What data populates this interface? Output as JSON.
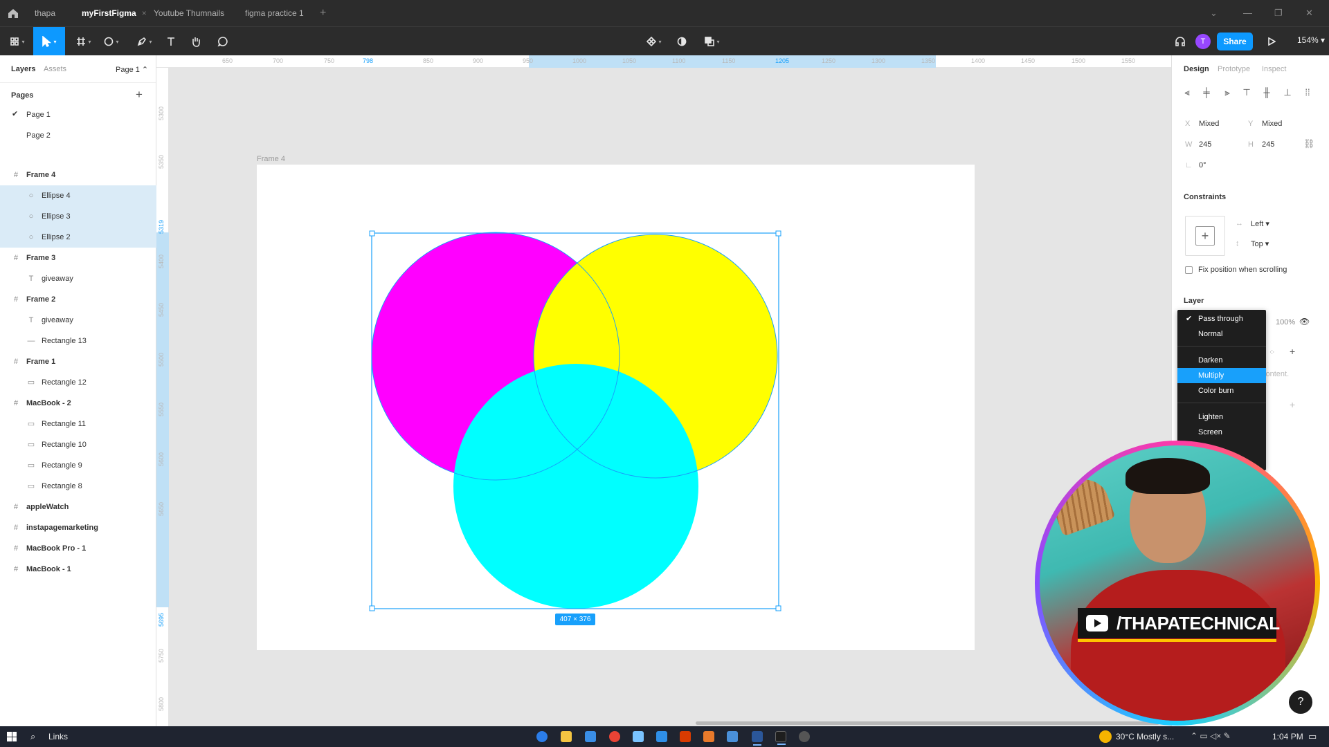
{
  "tabs": [
    {
      "label": "thapa",
      "active": false
    },
    {
      "label": "myFirstFigma",
      "active": true
    },
    {
      "label": "Youtube Thumnails",
      "active": false
    },
    {
      "label": "figma practice 1",
      "active": false
    }
  ],
  "toolbar": {
    "share_label": "Share",
    "zoom": "154%",
    "avatar_letter": "T"
  },
  "left_panel": {
    "tab_layers": "Layers",
    "tab_assets": "Assets",
    "page_selector": "Page 1",
    "pages_header": "Pages",
    "pages": [
      "Page 1",
      "Page 2"
    ],
    "layers": [
      {
        "label": "Frame 4",
        "type": "frame"
      },
      {
        "label": "Ellipse 4",
        "type": "ellipse"
      },
      {
        "label": "Ellipse 3",
        "type": "ellipse"
      },
      {
        "label": "Ellipse 2",
        "type": "ellipse"
      },
      {
        "label": "Frame 3",
        "type": "frame"
      },
      {
        "label": "giveaway",
        "type": "text"
      },
      {
        "label": "Frame 2",
        "type": "frame"
      },
      {
        "label": "giveaway",
        "type": "text"
      },
      {
        "label": "Rectangle 13",
        "type": "line"
      },
      {
        "label": "Frame 1",
        "type": "frame"
      },
      {
        "label": "Rectangle 12",
        "type": "rect"
      },
      {
        "label": "MacBook - 2",
        "type": "frame"
      },
      {
        "label": "Rectangle 11",
        "type": "rect"
      },
      {
        "label": "Rectangle 10",
        "type": "rect"
      },
      {
        "label": "Rectangle 9",
        "type": "rect"
      },
      {
        "label": "Rectangle 8",
        "type": "rect"
      },
      {
        "label": "appleWatch",
        "type": "frame"
      },
      {
        "label": "instapagemarketing",
        "type": "frame"
      },
      {
        "label": "MacBook Pro - 1",
        "type": "frame"
      },
      {
        "label": "MacBook - 1",
        "type": "frame"
      }
    ]
  },
  "rulers": {
    "h_ticks": [
      "650",
      "700",
      "750",
      "798",
      "850",
      "900",
      "950",
      "1000",
      "1050",
      "1100",
      "1150",
      "1205",
      "1250",
      "1300",
      "1350",
      "1400",
      "1450",
      "1500",
      "1550"
    ],
    "v_ticks": [
      "5300",
      "5350",
      "5319",
      "5400",
      "5450",
      "5500",
      "5550",
      "5600",
      "5650",
      "5695",
      "5750",
      "5800"
    ]
  },
  "canvas": {
    "frame_label": "Frame 4",
    "size_badge": "407 × 376",
    "colors": {
      "magenta": "#ff00ff",
      "yellow": "#ffff00",
      "cyan": "#00ffff",
      "selection": "#18a0fb"
    }
  },
  "right_panel": {
    "tab_design": "Design",
    "tab_prototype": "Prototype",
    "tab_inspect": "Inspect",
    "x_label": "X",
    "x_value": "Mixed",
    "y_label": "Y",
    "y_value": "Mixed",
    "w_label": "W",
    "w_value": "245",
    "h_label": "H",
    "h_value": "245",
    "rotation": "0°",
    "constraints_header": "Constraints",
    "constraint_h": "Left",
    "constraint_v": "Top",
    "fix_position": "Fix position when scrolling",
    "layer_header": "Layer",
    "opacity": "100%",
    "partial_text": "content."
  },
  "blend_menu": {
    "items": [
      "Pass through",
      "Normal",
      "Darken",
      "Multiply",
      "Color burn",
      "Lighten",
      "Screen"
    ],
    "checked": "Pass through",
    "highlighted": "Multiply"
  },
  "webcam": {
    "channel": "/THAPATECHNICAL"
  },
  "taskbar": {
    "search": "Links",
    "weather": "30°C  Mostly s...",
    "time": "1:04 PM"
  }
}
